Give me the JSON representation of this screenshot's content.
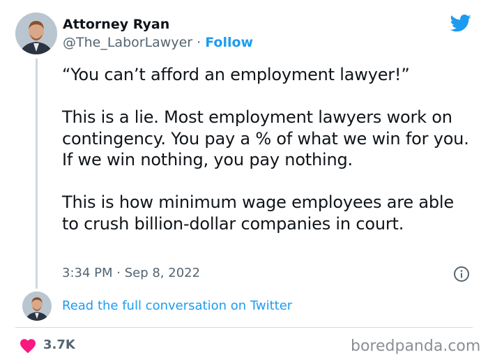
{
  "author": {
    "name": "Attorney Ryan",
    "handle": "@The_LaborLawyer",
    "separator": " · ",
    "follow_label": "Follow"
  },
  "tweet": {
    "text": "“You can’t afford an employment lawyer!”\n\nThis is a lie. Most employment lawyers work on contingency. You pay a % of what we win for you. If we win nothing, you pay nothing.\n\nThis is how minimum wage employees are able to crush billion-dollar companies in court.",
    "timestamp": "3:34 PM · Sep 8, 2022"
  },
  "conversation": {
    "link_label": "Read the full conversation on Twitter"
  },
  "engagement": {
    "likes": "3.7K"
  },
  "watermark": "boredpanda.com",
  "icons": [
    "twitter-bird-icon",
    "info-icon",
    "heart-icon"
  ],
  "colors": {
    "accent": "#1d9bf0",
    "heart": "#f91880",
    "text": "#0f1419",
    "secondary": "#536471"
  }
}
